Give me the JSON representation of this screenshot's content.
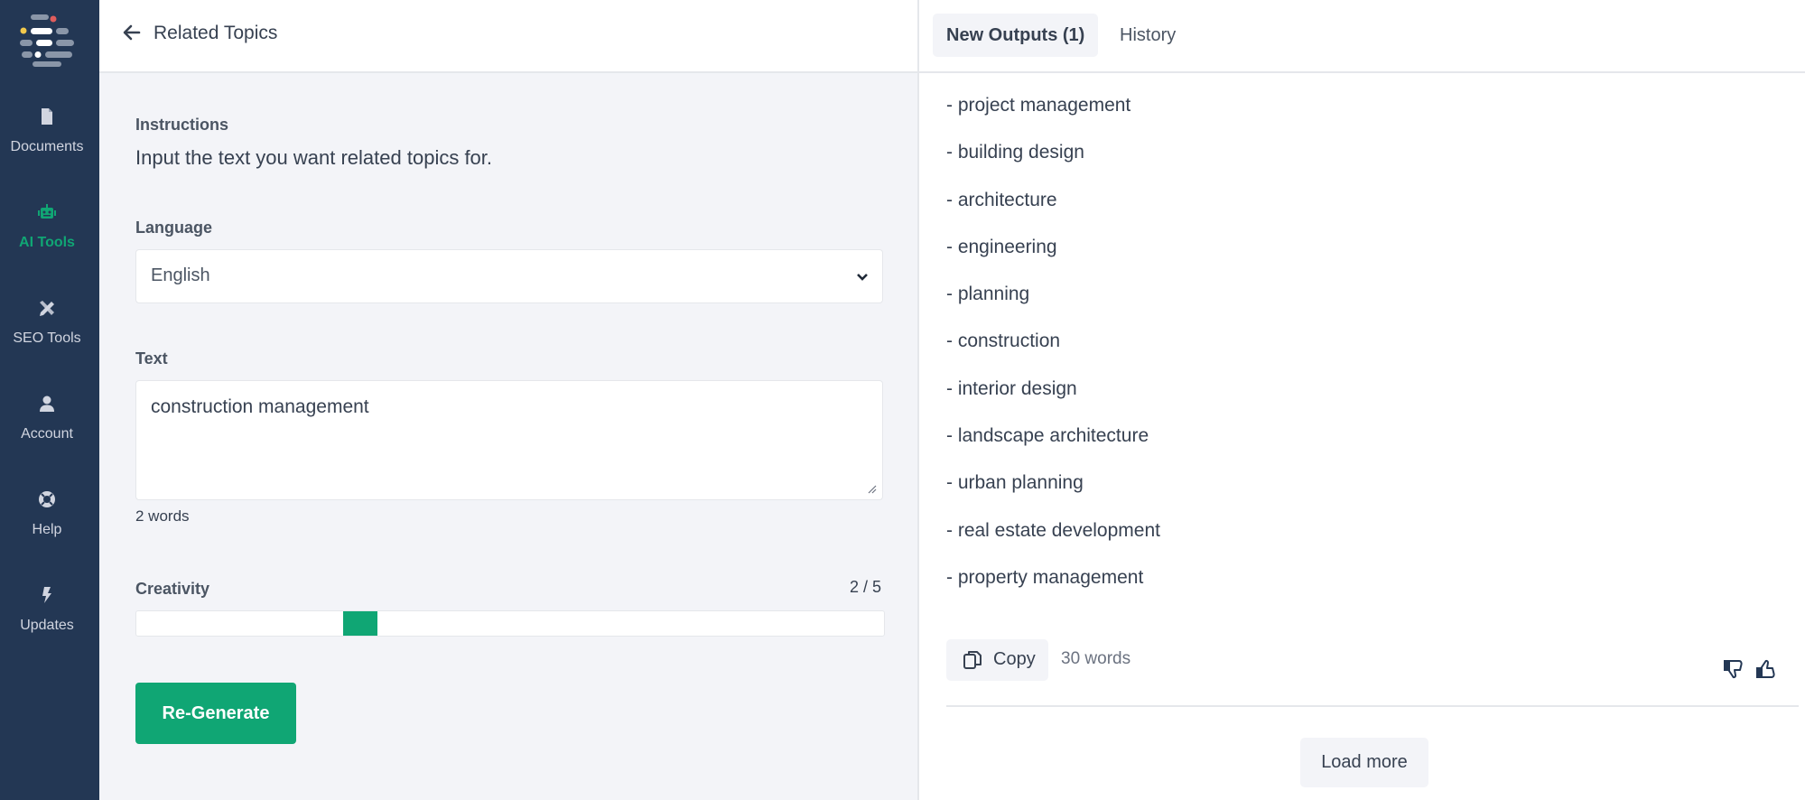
{
  "sidebar": {
    "items": [
      {
        "label": "Documents",
        "icon": "document-icon",
        "active": false
      },
      {
        "label": "AI Tools",
        "icon": "robot-icon",
        "active": true
      },
      {
        "label": "SEO Tools",
        "icon": "tools-icon",
        "active": false
      },
      {
        "label": "Account",
        "icon": "user-icon",
        "active": false
      },
      {
        "label": "Help",
        "icon": "lifebuoy-icon",
        "active": false
      },
      {
        "label": "Updates",
        "icon": "bolt-icon",
        "active": false
      }
    ]
  },
  "left": {
    "header_title": "Related Topics",
    "instructions_label": "Instructions",
    "instructions_text": "Input the text you want related topics for.",
    "language_label": "Language",
    "language_value": "English",
    "text_label": "Text",
    "text_value": "construction management",
    "text_word_count": "2 words",
    "creativity_label": "Creativity",
    "creativity_display": "2 / 5",
    "creativity_value": 2,
    "creativity_max": 5,
    "regenerate_label": "Re-Generate"
  },
  "right": {
    "tabs": [
      {
        "label": "New Outputs (1)",
        "active": true
      },
      {
        "label": "History",
        "active": false
      }
    ],
    "outputs": [
      "- project management",
      "- building design",
      "- architecture",
      "- engineering",
      "- planning",
      "- construction",
      "- interior design",
      "- landscape architecture",
      "- urban planning",
      "- real estate development",
      "- property management"
    ],
    "copy_label": "Copy",
    "word_count": "30 words",
    "load_more_label": "Load more"
  },
  "colors": {
    "sidebar_bg": "#233754",
    "accent": "#10a674",
    "panel_bg": "#f3f4f8"
  }
}
